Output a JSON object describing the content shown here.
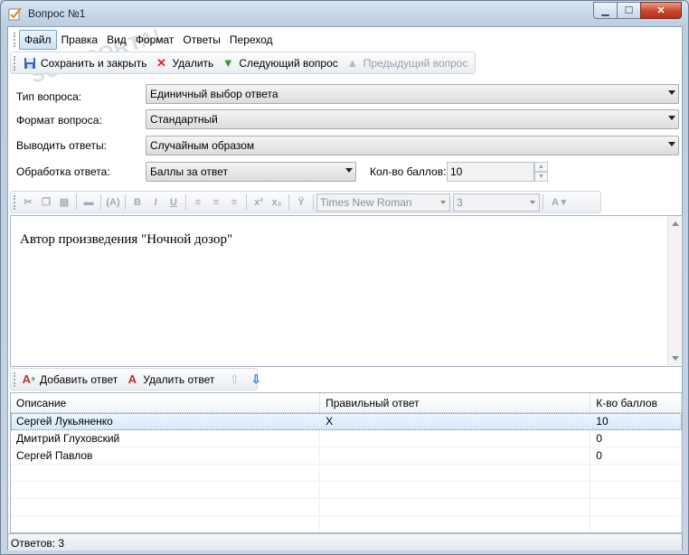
{
  "window": {
    "title": "Вопрос №1"
  },
  "menu": [
    "Файл",
    "Правка",
    "Вид",
    "Формат",
    "Ответы",
    "Переход"
  ],
  "toolbar": {
    "save_close": "Сохранить и закрыть",
    "delete": "Удалить",
    "next": "Следующий вопрос",
    "prev": "Предыдущий вопрос"
  },
  "form": {
    "question_type_label": "Тип вопроса:",
    "question_type_value": "Единичный выбор ответа",
    "question_format_label": "Формат вопроса:",
    "question_format_value": "Стандартный",
    "show_answers_label": "Выводить ответы:",
    "show_answers_value": "Случайным образом",
    "processing_label": "Обработка ответа:",
    "processing_value": "Баллы за ответ",
    "points_label": "Кол-во баллов:",
    "points_value": "10"
  },
  "format_toolbar": {
    "font": "Times New Roman",
    "size": "3"
  },
  "editor": {
    "text": "Автор произведения \"Ночной дозор\""
  },
  "answers_toolbar": {
    "add": "Добавить ответ",
    "remove": "Удалить ответ"
  },
  "grid": {
    "columns": [
      "Описание",
      "Правильный ответ",
      "К-во баллов"
    ],
    "rows": [
      [
        "Сергей Лукьяненко",
        "X",
        "10"
      ],
      [
        "Дмитрий Глуховский",
        "",
        "0"
      ],
      [
        "Сергей Павлов",
        "",
        "0"
      ]
    ]
  },
  "status": {
    "answers": "Ответов: 3"
  },
  "watermark": "SOFTPORTAL",
  "colors": {
    "accent": "#3a6ea5",
    "close": "#c8442b",
    "selection": "#d7e8fb"
  }
}
